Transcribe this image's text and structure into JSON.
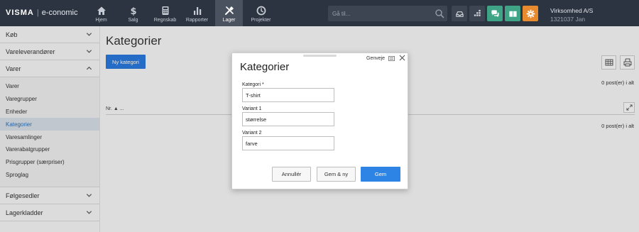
{
  "brand": {
    "name": "VISMA",
    "product": "e-conomic"
  },
  "nav": [
    {
      "label": "Hjem",
      "icon": "home-icon"
    },
    {
      "label": "Salg",
      "icon": "dollar-icon"
    },
    {
      "label": "Regnskab",
      "icon": "calculator-icon"
    },
    {
      "label": "Rapporter",
      "icon": "bar-chart-icon"
    },
    {
      "label": "Lager",
      "icon": "tools-icon"
    },
    {
      "label": "Projekter",
      "icon": "clock-icon"
    }
  ],
  "active_nav": "Lager",
  "search": {
    "placeholder": "Gå til..."
  },
  "company": {
    "name": "Virksomhed A/S",
    "id_user": "1321037 Jan"
  },
  "sidebar": {
    "sections": [
      {
        "label": "Køb",
        "expanded": false
      },
      {
        "label": "Vareleverandører",
        "expanded": false
      },
      {
        "label": "Varer",
        "expanded": true
      }
    ],
    "items": [
      {
        "label": "Varer"
      },
      {
        "label": "Varegrupper"
      },
      {
        "label": "Enheder"
      },
      {
        "label": "Kategorier",
        "active": true
      },
      {
        "label": "Varesamlinger"
      },
      {
        "label": "Varerabatgrupper"
      },
      {
        "label": "Prisgrupper (særpriser)"
      },
      {
        "label": "Sproglag"
      }
    ],
    "bottom_sections": [
      {
        "label": "Følgesedler"
      },
      {
        "label": "Lagerkladder"
      }
    ]
  },
  "main": {
    "title": "Kategorier",
    "new_button": "Ny kategori",
    "posts_top": "0 post(er) i alt",
    "posts_bottom": "0 post(er) i alt",
    "col_header": "Nr. ▲ ..."
  },
  "modal": {
    "title": "Kategorier",
    "shortcuts_label": "Genveje",
    "fields": [
      {
        "label": "Kategori *",
        "value": "T-shirt"
      },
      {
        "label": "Variant 1",
        "value": "størrelse"
      },
      {
        "label": "Variant 2",
        "value": "farve"
      }
    ],
    "buttons": {
      "cancel": "Annullér",
      "save_new": "Gem & ny",
      "save": "Gem"
    }
  },
  "colors": {
    "topbar": "#2c3441",
    "accent_blue": "#2877d9",
    "green_btn": "#3fa386",
    "orange_btn": "#e88a2e"
  }
}
